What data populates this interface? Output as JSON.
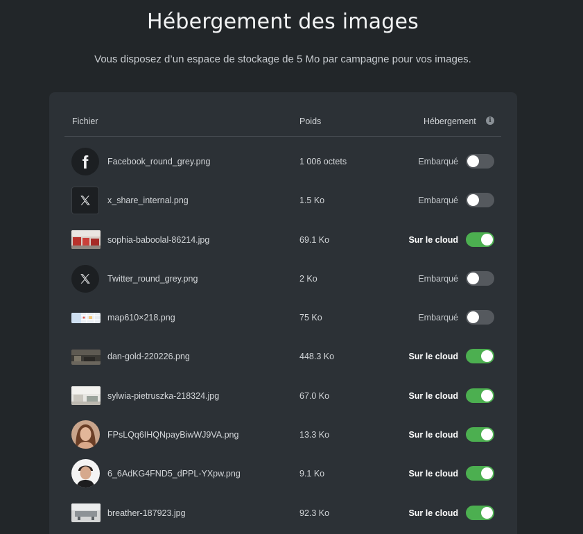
{
  "header": {
    "title": "Hébergement des images",
    "subtitle": "Vous disposez d’un espace de stockage de 5 Mo par campagne pour vos images."
  },
  "table": {
    "columns": {
      "file": "Fichier",
      "weight": "Poids",
      "hosting": "Hébergement",
      "hosting_info_icon": "info-icon"
    },
    "rows": [
      {
        "thumb": "facebook-icon",
        "name": "Facebook_round_grey.png",
        "size": "1 006 octets",
        "hosting": "Embarqué",
        "cloud": false
      },
      {
        "thumb": "x-logo-icon",
        "name": "x_share_internal.png",
        "size": "1.5 Ko",
        "hosting": "Embarqué",
        "cloud": false
      },
      {
        "thumb": "photo-thumbnail",
        "name": "sophia-baboolal-86214.jpg",
        "size": "69.1 Ko",
        "hosting": "Sur le cloud",
        "cloud": true
      },
      {
        "thumb": "x-logo-icon",
        "name": "Twitter_round_grey.png",
        "size": "2 Ko",
        "hosting": "Embarqué",
        "cloud": false
      },
      {
        "thumb": "map-thumbnail",
        "name": "map610×218.png",
        "size": "75 Ko",
        "hosting": "Embarqué",
        "cloud": false
      },
      {
        "thumb": "photo-thumbnail",
        "name": "dan-gold-220226.png",
        "size": "448.3 Ko",
        "hosting": "Sur le cloud",
        "cloud": true
      },
      {
        "thumb": "photo-thumbnail",
        "name": "sylwia-pietruszka-218324.jpg",
        "size": "67.0 Ko",
        "hosting": "Sur le cloud",
        "cloud": true
      },
      {
        "thumb": "avatar-photo",
        "name": "FPsLQq6IHQNpayBiwWJ9VA.png",
        "size": "13.3 Ko",
        "hosting": "Sur le cloud",
        "cloud": true
      },
      {
        "thumb": "avatar-photo",
        "name": "6_6AdKG4FND5_dPPL-YXpw.png",
        "size": "9.1 Ko",
        "hosting": "Sur le cloud",
        "cloud": true
      },
      {
        "thumb": "photo-thumbnail",
        "name": "breather-187923.jpg",
        "size": "92.3 Ko",
        "hosting": "Sur le cloud",
        "cloud": true
      }
    ]
  },
  "colors": {
    "background": "#222629",
    "card": "#2c3136",
    "toggle_on": "#4caf50",
    "toggle_off": "#55595e"
  }
}
